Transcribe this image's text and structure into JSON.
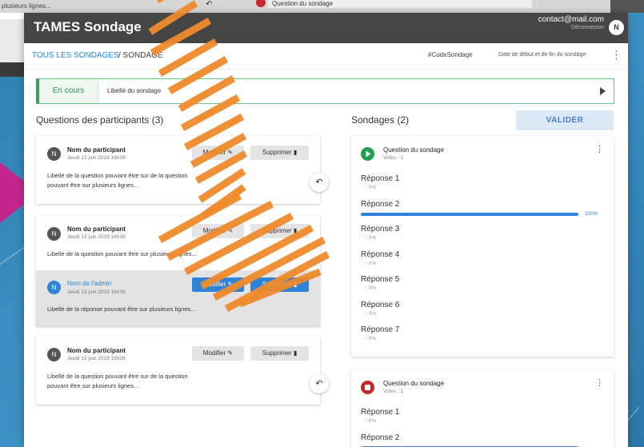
{
  "background": {
    "snippet": "plusieurs lignes...",
    "question_label": "Question du sondage"
  },
  "app": {
    "title": "TAMES Sondage",
    "user_email": "contact@mail.com",
    "logout": "Déconnexion",
    "avatar_initial": "N"
  },
  "breadcrumb": {
    "link": "TOUS LES SONDAGES",
    "rest": "/ SONDAGE",
    "code": "#CodeSondage",
    "dates": "Date de début et de fin du sondage"
  },
  "status": {
    "chip": "En cours",
    "label": "Libellé du sondage"
  },
  "questions_panel": {
    "heading": "Questions des participants (3)",
    "items": [
      {
        "initial": "N",
        "name": "Nom du participant",
        "date": "Jeudi 13 juin 2019 16h39",
        "text1": "Libellé de la question pouvant être sur de la question",
        "text2": "pouvant être sur plusieurs lignes...",
        "modify": "Modifier ✎",
        "delete": "Supprimer ▮"
      },
      {
        "initial": "N",
        "name": "Nom du participant",
        "date": "Jeudi 13 juin 2019 16h39",
        "text1": "Libellé de la question pouvant être sur plusieurs lignes...",
        "modify": "Modifier ✎",
        "delete": "Supprimer ▮",
        "admin": {
          "initial": "N",
          "name": "Nom de l'admin",
          "date": "Jeudi 13 juin 2019 16h39",
          "text": "Libellé de la réponse pouvant être sur plusieurs lignes...",
          "modify": "Modifier ✎",
          "delete": "Supprimer ▮"
        }
      },
      {
        "initial": "N",
        "name": "Nom du participant",
        "date": "Jeudi 13 juin 2019 16h39",
        "text1": "Libellé de la question pouvant être sur de la question",
        "text2": "pouvant être sur plusieurs lignes...",
        "modify": "Modifier ✎",
        "delete": "Supprimer ▮"
      }
    ],
    "reply_icon": "↶"
  },
  "polls_panel": {
    "heading": "Sondages (2)",
    "validate": "VALIDER",
    "polls": [
      {
        "state": "play",
        "title": "Question du sondage",
        "votes": "Votes : 1",
        "responses": [
          {
            "label": "Réponse 1",
            "pct": "0%",
            "value": 0
          },
          {
            "label": "Réponse 2",
            "pct": "100%",
            "value": 100
          },
          {
            "label": "Réponse 3",
            "pct": "0%",
            "value": 0
          },
          {
            "label": "Réponse 4",
            "pct": "0%",
            "value": 0
          },
          {
            "label": "Réponse 5",
            "pct": "0%",
            "value": 0
          },
          {
            "label": "Réponse 6",
            "pct": "0%",
            "value": 0
          },
          {
            "label": "Réponse 7",
            "pct": "0%",
            "value": 0
          }
        ]
      },
      {
        "state": "stop",
        "title": "Question du sondage",
        "votes": "Votes : 1",
        "responses": [
          {
            "label": "Réponse 1",
            "pct": "0%",
            "value": 0
          },
          {
            "label": "Réponse 2",
            "pct": "",
            "value": 100
          }
        ]
      }
    ]
  },
  "colors": {
    "play": "#1f9d55",
    "stop": "#c62828",
    "accent": "#2f83d8",
    "stripe": "#ef8b2c"
  }
}
